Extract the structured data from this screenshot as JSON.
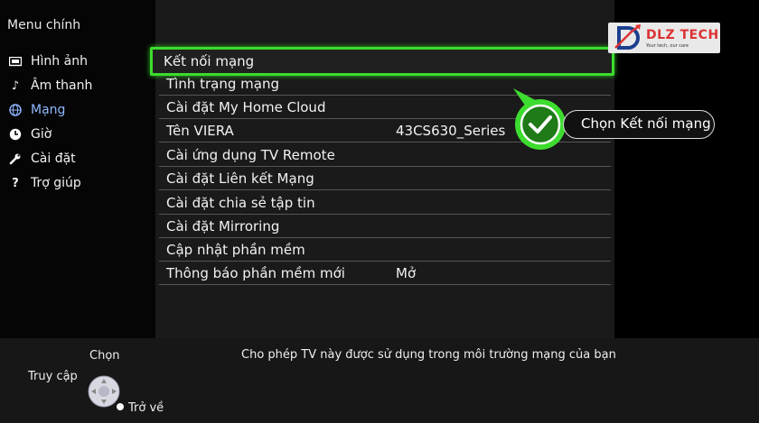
{
  "sidebar": {
    "title": "Menu chính",
    "items": [
      {
        "label": "Hình ảnh",
        "icon": "picture-icon"
      },
      {
        "label": "Âm thanh",
        "icon": "music-note-icon"
      },
      {
        "label": "Mạng",
        "icon": "globe-icon"
      },
      {
        "label": "Giờ",
        "icon": "clock-icon"
      },
      {
        "label": "Cài đặt",
        "icon": "wrench-icon"
      },
      {
        "label": "Trợ giúp",
        "icon": "question-icon"
      }
    ]
  },
  "menu": {
    "items": [
      {
        "label": "Kết nối mạng",
        "value": ""
      },
      {
        "label": "Tình trạng mạng",
        "value": ""
      },
      {
        "label": "Cài đặt My Home Cloud",
        "value": ""
      },
      {
        "label": "Tên VIERA",
        "value": "43CS630_Series"
      },
      {
        "label": "Cài ứng dụng TV Remote",
        "value": ""
      },
      {
        "label": "Cài đặt Liên kết Mạng",
        "value": ""
      },
      {
        "label": "Cài đặt chia sẻ tập tin",
        "value": ""
      },
      {
        "label": "Cài đặt Mirroring",
        "value": ""
      },
      {
        "label": "Cập nhật phần mềm",
        "value": ""
      },
      {
        "label": "Thông báo phần mềm mới",
        "value": "Mở"
      }
    ]
  },
  "logo": {
    "text": "DLZ TECH",
    "subtext": "Your tech, our care"
  },
  "callout": {
    "text": "Chọn Kết nối mạng"
  },
  "footer": {
    "select_label": "Chọn",
    "access_label": "Truy cập",
    "back_label": "Trở về",
    "description": "Cho phép TV này được sử dụng trong môi trường mạng của bạn"
  },
  "colors": {
    "highlight": "#3ddc2f",
    "active_menu": "#8fb8ff"
  }
}
